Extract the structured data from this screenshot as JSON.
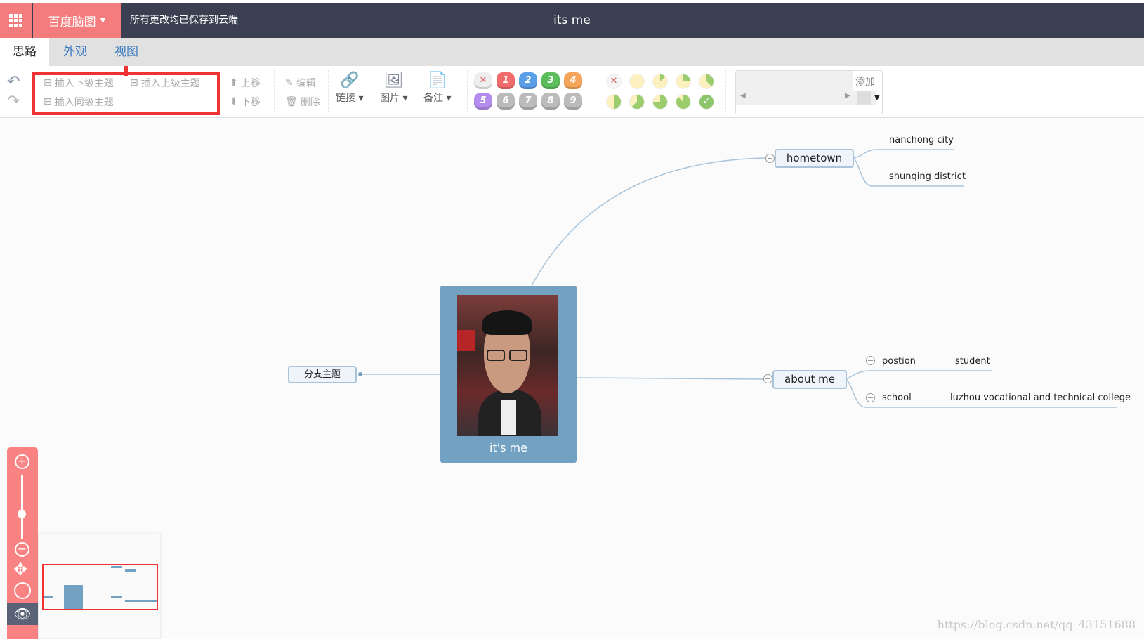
{
  "header": {
    "brand": "百度脑图",
    "saved_status": "所有更改均已保存到云端",
    "title": "its me"
  },
  "tabs": [
    {
      "label": "思路",
      "active": true
    },
    {
      "label": "外观"
    },
    {
      "label": "视图"
    }
  ],
  "toolbar": {
    "insert_child": "插入下级主题",
    "insert_parent": "插入上级主题",
    "insert_sibling": "插入同级主题",
    "move_up": "上移",
    "move_down": "下移",
    "edit": "编辑",
    "delete": "删除",
    "link": "链接",
    "image": "图片",
    "note": "备注",
    "priority": [
      "1",
      "2",
      "3",
      "4",
      "5",
      "6",
      "7",
      "8",
      "9"
    ],
    "priority_colors": [
      "#f06b6b",
      "#5b9ee8",
      "#5bbd5b",
      "#f5a55a",
      "#b48ced",
      "#bbbbbb",
      "#bbbbbb",
      "#bbbbbb",
      "#bbbbbb"
    ],
    "progress_levels": [
      0,
      0,
      0.125,
      0.25,
      0.375,
      0.5,
      0.625,
      0.75,
      0.875,
      1
    ],
    "resource_add": "添加"
  },
  "mindmap": {
    "root": "it's me",
    "left_branch": "分支主题",
    "hometown": {
      "label": "hometown",
      "children": [
        "nanchong city",
        "shunqing district"
      ]
    },
    "about": {
      "label": "about me",
      "children": [
        {
          "label": "postion",
          "value": "student"
        },
        {
          "label": "school",
          "value": "luzhou vocational and technical college"
        }
      ]
    }
  },
  "colors": {
    "accent": "#f47c7c",
    "header_bg": "#3a4051",
    "node_border": "#a9c4da",
    "root_bg": "#73a1c2",
    "highlight": "#f03232"
  },
  "watermark": "https://blog.csdn.net/qq_43151688"
}
